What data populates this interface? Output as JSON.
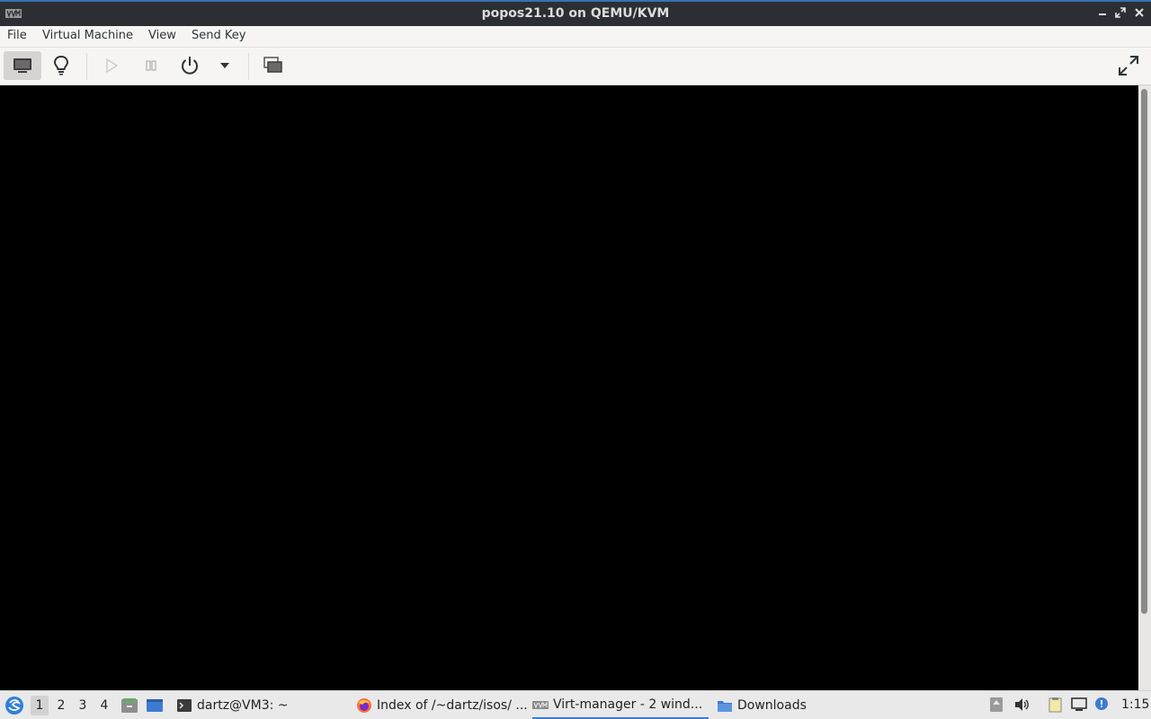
{
  "window": {
    "title": "popos21.10 on QEMU/KVM",
    "controls": {
      "minimize": "▁",
      "restore": "⤢",
      "close": "✕"
    }
  },
  "menubar": {
    "items": [
      {
        "label": "File"
      },
      {
        "label": "Virtual Machine"
      },
      {
        "label": "View"
      },
      {
        "label": "Send Key"
      }
    ]
  },
  "toolbar": {
    "buttons": [
      {
        "name": "console-view",
        "icon": "monitor-icon",
        "active": true
      },
      {
        "name": "details-view",
        "icon": "lightbulb-icon",
        "active": false
      },
      {
        "name": "run",
        "icon": "play-icon",
        "enabled": false
      },
      {
        "name": "pause",
        "icon": "pause-icon",
        "enabled": false
      },
      {
        "name": "shutdown",
        "icon": "power-icon"
      },
      {
        "name": "shutdown-menu",
        "icon": "dropdown-arrow-icon"
      },
      {
        "name": "snapshots",
        "icon": "snapshots-icon"
      },
      {
        "name": "fullscreen",
        "icon": "fullscreen-icon"
      }
    ]
  },
  "taskbar": {
    "workspaces": [
      "1",
      "2",
      "3",
      "4"
    ],
    "current_workspace": "1",
    "tasks": [
      {
        "label": "dartz@VM3: ~",
        "icon": "terminal-icon",
        "active": false
      },
      {
        "label": "Index of /~dartz/isos/ ...",
        "icon": "firefox-icon",
        "active": false
      },
      {
        "label": "Virt-manager - 2 wind...",
        "icon": "virt-manager-icon",
        "active": true
      },
      {
        "label": "Downloads",
        "icon": "folder-icon",
        "active": false
      }
    ],
    "clock": "1:15"
  },
  "colors": {
    "titlebar_bg": "#2b2f33",
    "accent": "#3b6fb3",
    "toolbar_bg": "#f6f5f4",
    "console_bg": "#000000",
    "taskbar_bg": "#e9e9e9"
  }
}
